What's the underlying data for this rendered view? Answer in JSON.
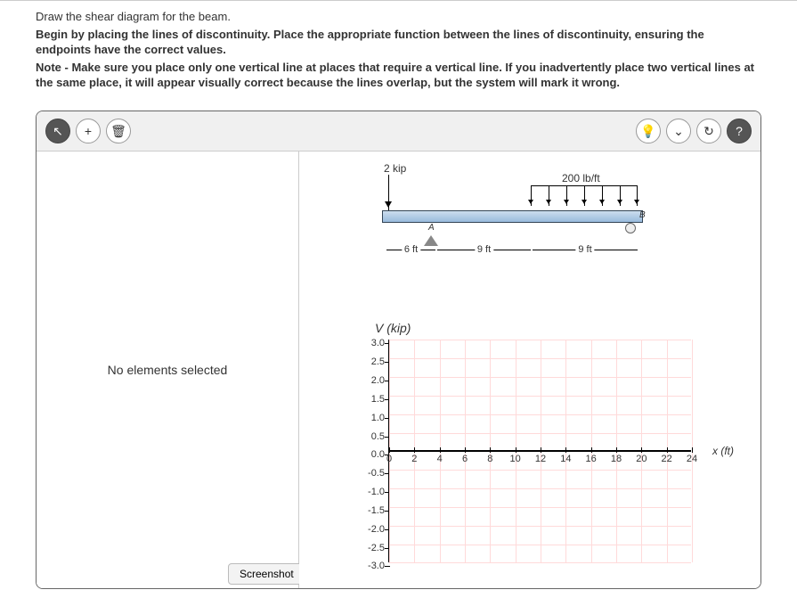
{
  "instructions": {
    "line1": "Draw the shear diagram for the beam.",
    "line2": "Begin by placing the lines of discontinuity. Place the appropriate function between the lines of discontinuity, ensuring the endpoints have the correct values.",
    "line3": "Note - Make sure you place only one vertical line at places that require a vertical line. If you inadvertently place two vertical lines at the same place, it will appear visually correct because the lines overlap, but the system will mark it wrong."
  },
  "toolbar": {
    "cursor_tool": "↖",
    "add_tool": "+",
    "delete_tool": "🗑",
    "hint_tool": "💡",
    "dropdown_tool": "⌄",
    "refresh_tool": "↻",
    "help_tool": "?"
  },
  "left_panel": {
    "status": "No elements selected"
  },
  "beam": {
    "point_load": "2 kip",
    "dist_load": "200 lb/ft",
    "label_a": "A",
    "label_b": "B",
    "dim1": "6 ft",
    "dim2": "9 ft",
    "dim3": "9 ft"
  },
  "chart": {
    "ylabel": "V (kip)",
    "xlabel": "x (ft)"
  },
  "chart_data": {
    "type": "line",
    "title": "V (kip)",
    "xlabel": "x (ft)",
    "ylabel": "V (kip)",
    "xlim": [
      0,
      24
    ],
    "ylim": [
      -3.0,
      3.0
    ],
    "xticks": [
      0,
      2,
      4,
      6,
      8,
      10,
      12,
      14,
      16,
      18,
      20,
      22,
      24
    ],
    "yticks": [
      3.0,
      2.5,
      2.0,
      1.5,
      1.0,
      0.5,
      0.0,
      -0.5,
      -1.0,
      -1.5,
      -2.0,
      -2.5,
      -3.0
    ],
    "series": []
  },
  "screenshot_label": "Screenshot"
}
